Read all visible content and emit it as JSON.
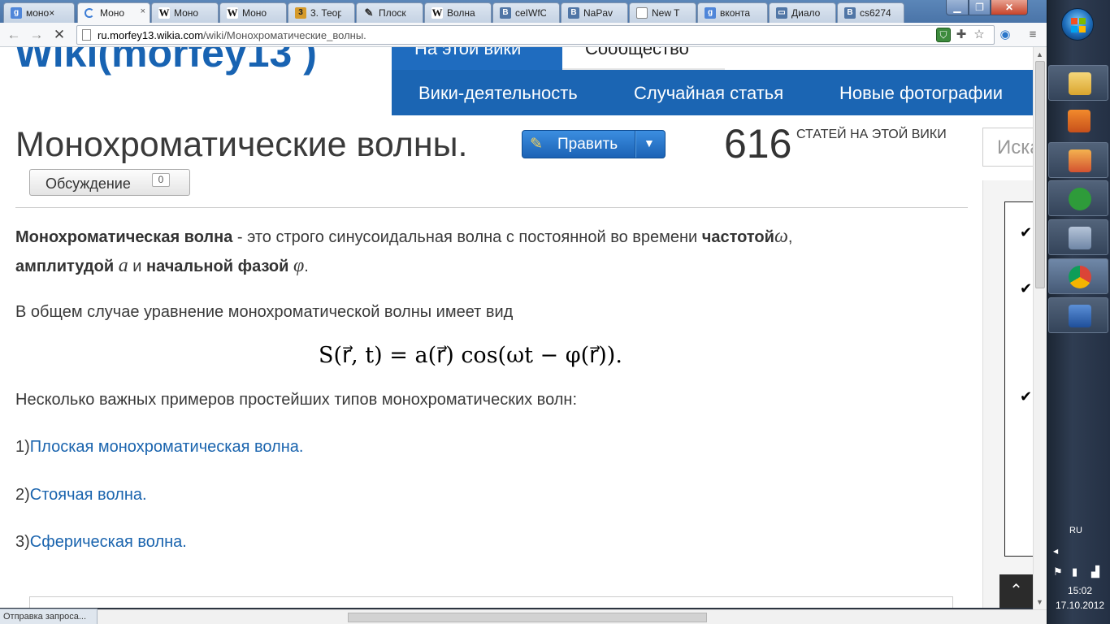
{
  "browser": {
    "tabs": [
      {
        "label": "моно×",
        "icon": "google-icon"
      },
      {
        "label": "Моно",
        "icon": "loading-icon"
      },
      {
        "label": "Моно",
        "icon": "wikipedia-icon"
      },
      {
        "label": "Моно",
        "icon": "wikipedia-icon"
      },
      {
        "label": "3. Теор",
        "icon": "book-icon"
      },
      {
        "label": "Плоск",
        "icon": "pin-icon"
      },
      {
        "label": "Волна",
        "icon": "wikipedia-icon"
      },
      {
        "label": "ceIWfC",
        "icon": "vk-icon"
      },
      {
        "label": "NaPav",
        "icon": "vk-icon"
      },
      {
        "label": "New T",
        "icon": "document-icon"
      },
      {
        "label": "вконта",
        "icon": "google-icon"
      },
      {
        "label": "Диало",
        "icon": "message-icon"
      },
      {
        "label": "cs6274",
        "icon": "vk-icon"
      }
    ],
    "url_domain": "ru.morfey13.wikia.com",
    "url_path": "/wiki/Монохроматические_волны.",
    "status_text": "Отправка запроса..."
  },
  "wiki": {
    "logo": "Wiki(morfey13 )",
    "tab_wiki": "На этой вики",
    "tab_community": "Сообщество",
    "nav": [
      "Вики-деятельность",
      "Случайная статья",
      "Новые фотографии"
    ],
    "search_placeholder": "Иска",
    "article_count": "616",
    "article_count_label": "СТАТЕЙ НА ЭТОЙ ВИКИ"
  },
  "article": {
    "title": "Монохроматические волны.",
    "edit_label": "Править",
    "talk_label": "Обсуждение",
    "talk_count": "0",
    "p1_bold1": "Монохроматическая волна",
    "p1_text1": " - это строго синусоидальная волна с постоянной во времени ",
    "p1_bold2": "частотой",
    "p1_sym1": "ω",
    "p1_comma": ",",
    "p2_bold1": "амплитудой",
    "p2_sym1": "a",
    "p2_and": " и ",
    "p2_bold2": "начальной фазой",
    "p2_sym2": "φ",
    "p2_end": ".",
    "p3": "В общем случае уравнение монохроматической волны имеет вид",
    "formula": "S(r⃗, t) = a(r⃗) cos(ωt − φ(r⃗)).",
    "p4": "Несколько важных примеров простейших типов монохроматических волн:",
    "examples": [
      {
        "num": "1)",
        "link": "Плоская монохроматическая волна."
      },
      {
        "num": "2)",
        "link": "Стоячая волна."
      },
      {
        "num": "3)",
        "link": "Сферическая волна."
      }
    ]
  },
  "taskbar": {
    "lang": "RU",
    "time": "15:02",
    "date": "17.10.2012"
  },
  "colors": {
    "wiki_blue": "#1b65b3",
    "link": "#1a64ae",
    "edit_button": "#2a78cc"
  }
}
